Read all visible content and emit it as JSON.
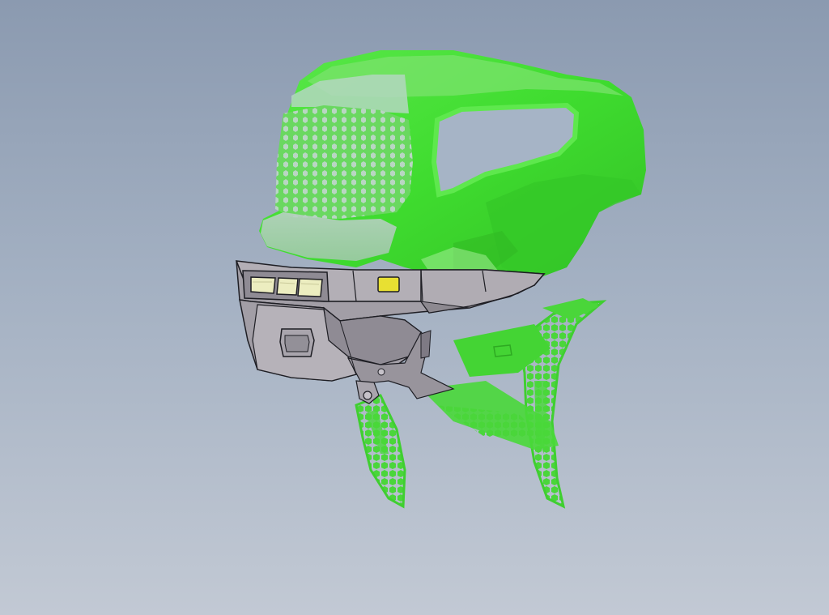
{
  "viewport": {
    "background_top": "#8b9ab0",
    "background_bottom": "#c2c9d4"
  },
  "model": {
    "scan_color": "#3fdc2f",
    "scan_highlight": "#8af07c",
    "scan_glass": "#b8d6c0",
    "bumper_fill": "#a9a4ac",
    "bumper_dark": "#8c8790",
    "bumper_edge": "#1e1e24",
    "light_bar_color": "#ecedc0",
    "marker_light_color": "#e8e032"
  }
}
